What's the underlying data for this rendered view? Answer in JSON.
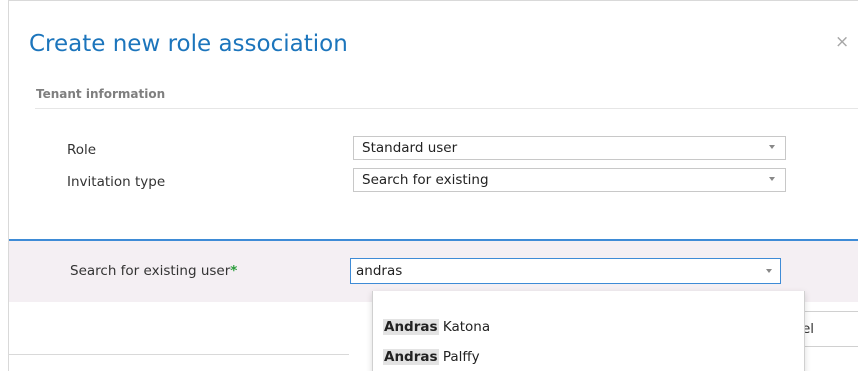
{
  "dialog": {
    "title": "Create new role association",
    "close_glyph": "×"
  },
  "section": {
    "label": "Tenant information"
  },
  "fields": {
    "role": {
      "label": "Role",
      "value": "Standard user"
    },
    "invitation_type": {
      "label": "Invitation type",
      "value": "Search for existing"
    }
  },
  "search": {
    "label": "Search for existing user",
    "required_mark": "*",
    "value": "andras"
  },
  "suggestions": [
    {
      "match": "Andras",
      "rest": " Katona"
    },
    {
      "match": "Andras",
      "rest": " Palffy"
    }
  ],
  "buttons": {
    "cancel_label": "ncel"
  },
  "colors": {
    "title": "#1c75bc",
    "accent": "#3e8bd6",
    "required": "#2a9d3b",
    "band": "#f4eff3"
  },
  "icons": {
    "close": "close-icon",
    "dropdown": "chevron-down-icon"
  }
}
